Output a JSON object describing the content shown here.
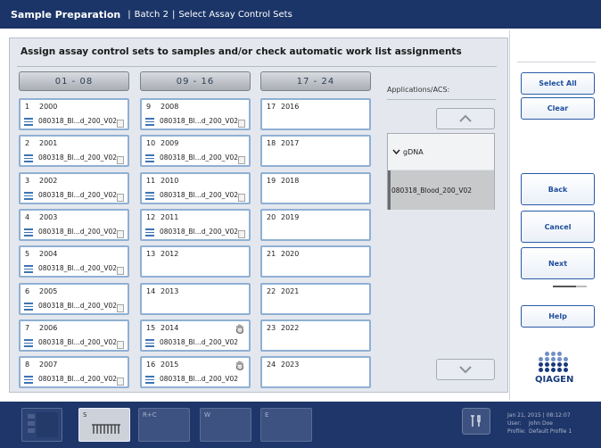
{
  "header": {
    "title": "Sample Preparation",
    "batch": "Batch 2",
    "step": "Select Assay Control Sets"
  },
  "instruction": "Assign assay control sets to samples and/or check automatic work list assignments",
  "columns": [
    "01 - 08",
    "09 - 16",
    "17 - 24"
  ],
  "slots": [
    {
      "num": "1",
      "id": "2000",
      "acs": "080318_Bl...d_200_V02"
    },
    {
      "num": "2",
      "id": "2001",
      "acs": "080318_Bl...d_200_V02"
    },
    {
      "num": "3",
      "id": "2002",
      "acs": "080318_Bl...d_200_V02"
    },
    {
      "num": "4",
      "id": "2003",
      "acs": "080318_Bl...d_200_V02"
    },
    {
      "num": "5",
      "id": "2004",
      "acs": "080318_Bl...d_200_V02"
    },
    {
      "num": "6",
      "id": "2005",
      "acs": "080318_Bl...d_200_V02"
    },
    {
      "num": "7",
      "id": "2006",
      "acs": "080318_Bl...d_200_V02"
    },
    {
      "num": "8",
      "id": "2007",
      "acs": "080318_Bl...d_200_V02"
    },
    {
      "num": "9",
      "id": "2008",
      "acs": "080318_Bl...d_200_V02"
    },
    {
      "num": "10",
      "id": "2009",
      "acs": "080318_Bl...d_200_V02"
    },
    {
      "num": "11",
      "id": "2010",
      "acs": "080318_Bl...d_200_V02"
    },
    {
      "num": "12",
      "id": "2011",
      "acs": "080318_Bl...d_200_V02"
    },
    {
      "num": "13",
      "id": "2012",
      "acs": ""
    },
    {
      "num": "14",
      "id": "2013",
      "acs": ""
    },
    {
      "num": "15",
      "id": "2014",
      "acs": "080318_Bl...d_200_V02"
    },
    {
      "num": "16",
      "id": "2015",
      "acs": "080318_Bl...d_200_V02"
    },
    {
      "num": "17",
      "id": "2016",
      "acs": ""
    },
    {
      "num": "18",
      "id": "2017",
      "acs": ""
    },
    {
      "num": "19",
      "id": "2018",
      "acs": ""
    },
    {
      "num": "20",
      "id": "2019",
      "acs": ""
    },
    {
      "num": "21",
      "id": "2020",
      "acs": ""
    },
    {
      "num": "22",
      "id": "2021",
      "acs": ""
    },
    {
      "num": "23",
      "id": "2022",
      "acs": ""
    },
    {
      "num": "24",
      "id": "2023",
      "acs": ""
    }
  ],
  "applications": {
    "title": "Applications/ACS:",
    "group": "gDNA",
    "item": "080318_Blood_200_V02"
  },
  "buttons": {
    "select_all": "Select All",
    "clear": "Clear",
    "back": "Back",
    "cancel": "Cancel",
    "next": "Next",
    "help": "Help"
  },
  "logo": "QIAGEN",
  "footer": {
    "tabs": [
      "S",
      "R+C",
      "W",
      "E"
    ],
    "datetime": "Jan 21, 2015 | 08:12:07",
    "user_label": "User:",
    "user": "John Doe",
    "profile_label": "Profile:",
    "profile": "Default Profile 1",
    "tool_icon": "tools-icon"
  },
  "colors": {
    "header": "#1b3568",
    "slot_border": "#8fb0d4",
    "button_text": "#1d4e9c"
  }
}
